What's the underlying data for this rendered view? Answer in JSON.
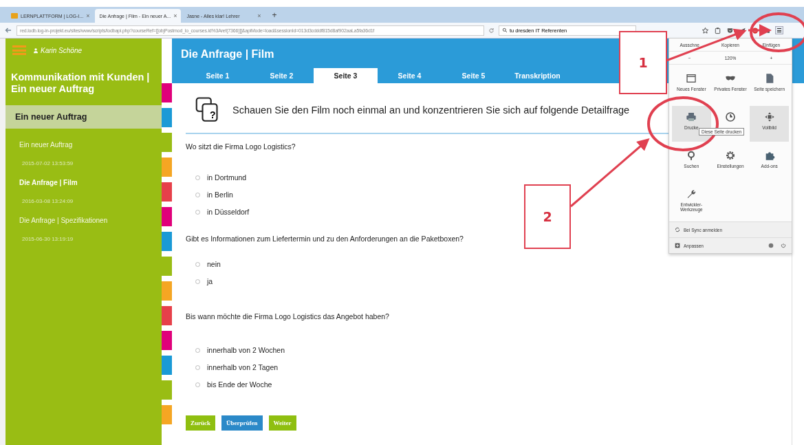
{
  "browser": {
    "tabs": [
      {
        "label": "LERNPLATTFORM | LOG-I...",
        "close": "×",
        "selected": false
      },
      {
        "label": "Die Anfrage | Film - Ein neuer A...",
        "close": "×",
        "selected": true
      },
      {
        "label": "Jasne - Alles klar! Lehrer",
        "close": "×",
        "selected": false
      }
    ],
    "new_tab": "+",
    "url": "red.lodb.log-in-projekt.eu/sites/www/scripts/lodbapi.php?courseRef=[[objPostmod_lo_courses.id%3Aref(7366)]]&apiMode=load&sessionId=013d3cdddf815d8af902aaLa5fa36d1f",
    "search": "tu dresden IT Referenten"
  },
  "sidebar": {
    "user": "Karin Schöne",
    "course_title": "Kommunikation mit Kunden | Ein neuer Auftrag",
    "section": "Ein neuer Auftrag",
    "items": [
      {
        "title": "Ein neuer Auftrag",
        "date": "2015-07-02 13:53:59",
        "selected": false
      },
      {
        "title": "Die Anfrage | Film",
        "date": "2016-03-08 13:24:09",
        "selected": true
      },
      {
        "title": "Die Anfrage | Spezifikationen",
        "date": "2015-06-30 13:19:19",
        "selected": false
      }
    ]
  },
  "page": {
    "title": "Die Anfrage | Film",
    "tabs": [
      {
        "label": "Seite 1",
        "selected": false
      },
      {
        "label": "Seite 2",
        "selected": false
      },
      {
        "label": "Seite 3",
        "selected": true
      },
      {
        "label": "Seite 4",
        "selected": false
      },
      {
        "label": "Seite 5",
        "selected": false
      },
      {
        "label": "Transkription",
        "selected": false
      }
    ],
    "icon_mark": "?",
    "instruction": "Schauen Sie den Film noch einmal an und konzentrieren Sie sich auf folgende Detailfrage",
    "questions": [
      {
        "text": "Wo sitzt die Firma Logo Logistics?",
        "options": [
          {
            "label": "in Dortmund",
            "selected": false
          },
          {
            "label": "in Berlin",
            "selected": false
          },
          {
            "label": "in Düsseldorf",
            "selected": false
          }
        ]
      },
      {
        "text": "Gibt es Informationen zum Liefertermin und zu den Anforderungen an die Paketboxen?",
        "options": [
          {
            "label": "nein",
            "selected": false
          },
          {
            "label": "ja",
            "selected": false
          }
        ]
      },
      {
        "text": "Bis wann möchte die Firma Logo Logistics das Angebot haben?",
        "options": [
          {
            "label": "innerhalb von 2 Wochen",
            "selected": false
          },
          {
            "label": "innerhalb von 2 Tagen",
            "selected": false
          },
          {
            "label": "bis Ende der Woche",
            "selected": false
          }
        ]
      }
    ],
    "buttons": [
      {
        "label": "Zurück",
        "kind": "nav"
      },
      {
        "label": "Überprüfen",
        "kind": "check"
      },
      {
        "label": "Weiter",
        "kind": "nav"
      }
    ]
  },
  "menu": {
    "edit": [
      "Ausschne",
      "Kopieren",
      "Einfügen"
    ],
    "zoom": [
      "−",
      "120%",
      "+"
    ],
    "items": [
      {
        "kind": "window",
        "label": "Neues Fenster",
        "highlighted": false
      },
      {
        "kind": "mask",
        "label": "Privates Fenster",
        "highlighted": false
      },
      {
        "kind": "page",
        "label": "Seite speichern",
        "highlighted": false
      },
      {
        "kind": "printer",
        "label": "Drucke",
        "highlighted": true
      },
      {
        "kind": "clock",
        "highlighted": false
      },
      {
        "kind": "fullscreen",
        "label": "Vollbild",
        "highlighted": true
      },
      {
        "kind": "search",
        "label": "Suchen",
        "highlighted": false
      },
      {
        "kind": "gear",
        "label": "Einstellungen",
        "highlighted": false
      },
      {
        "kind": "puzzle",
        "label": "Add-ons",
        "highlighted": false
      },
      {
        "kind": "wrench",
        "label": "Entwickler-Werkzeuge",
        "highlighted": false
      }
    ],
    "tooltip": "Diese Seite drucken",
    "sync": "Bei Sync anmelden",
    "customize": "Anpassen"
  },
  "annotations": [
    {
      "label": "1"
    },
    {
      "label": "2"
    }
  ]
}
